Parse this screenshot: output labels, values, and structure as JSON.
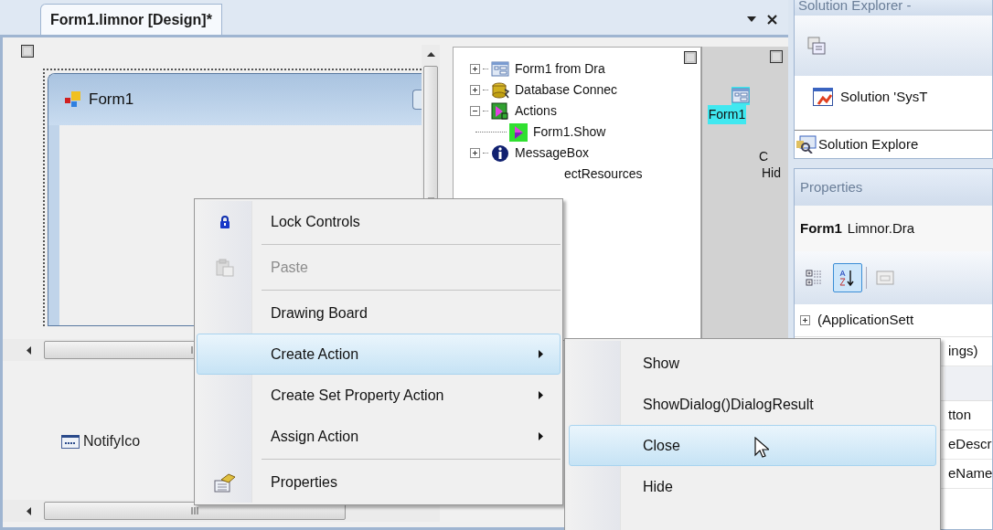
{
  "document_tab": {
    "title": "Form1.limnor [Design]*",
    "selected": true
  },
  "designer": {
    "form_title": "Form1",
    "component_tray": [
      {
        "label": "NotifyIco"
      }
    ]
  },
  "object_tree": [
    {
      "kind": "form",
      "label": "Form1 from Dra",
      "expanded": false
    },
    {
      "kind": "database",
      "label": "Database Connec",
      "expanded": false
    },
    {
      "kind": "actions",
      "label": "Actions",
      "expanded": true,
      "children": [
        {
          "kind": "action",
          "label": "Form1.Show"
        }
      ]
    },
    {
      "kind": "info",
      "label": "MessageBox",
      "expanded": false
    },
    {
      "kind": "covered",
      "label": "ectResources"
    }
  ],
  "component_strip": {
    "selected_label": "Form1",
    "texts": [
      "C",
      "Hid"
    ]
  },
  "solution_explorer": {
    "title": "Solution Explorer -",
    "tree": [
      {
        "label": "Solution 'SysT"
      }
    ],
    "tab": "Solution Explore"
  },
  "properties": {
    "title": "Properties",
    "object_name": "Form1",
    "object_type": "Limnor.Dra",
    "toolbar": [
      {
        "kind": "categorized",
        "selected": false
      },
      {
        "kind": "alphabetical",
        "selected": true
      },
      {
        "kind": "pages",
        "selected": false
      }
    ],
    "rows": [
      {
        "kind": "expandable",
        "label": "(ApplicationSett",
        "expanded": false
      },
      {
        "kind": "property",
        "label": "ings)"
      },
      {
        "kind": "category"
      },
      {
        "kind": "property",
        "label": "tton"
      },
      {
        "kind": "property",
        "label": "eDescr"
      },
      {
        "kind": "property",
        "label": "eName"
      }
    ]
  },
  "context_menu": {
    "items": [
      {
        "label": "Lock Controls",
        "kind": "lock",
        "disabled": false,
        "selected": false,
        "submenu": false,
        "separator_after": true
      },
      {
        "label": "Paste",
        "kind": "paste",
        "disabled": true,
        "selected": false,
        "submenu": false,
        "separator_after": true
      },
      {
        "label": "Drawing Board",
        "disabled": false,
        "selected": false,
        "submenu": false,
        "separator_after": false
      },
      {
        "label": "Create Action",
        "disabled": false,
        "selected": true,
        "submenu": true,
        "separator_after": false
      },
      {
        "label": "Create Set Property Action",
        "disabled": false,
        "selected": false,
        "submenu": true,
        "separator_after": false
      },
      {
        "label": "Assign Action",
        "disabled": false,
        "selected": false,
        "submenu": true,
        "separator_after": true
      },
      {
        "label": "Properties",
        "kind": "properties",
        "disabled": false,
        "selected": false,
        "submenu": false,
        "separator_after": false
      }
    ]
  },
  "submenu": {
    "items": [
      {
        "label": "Show",
        "selected": false
      },
      {
        "label": "ShowDialog()DialogResult",
        "selected": false
      },
      {
        "label": "Close",
        "selected": true
      },
      {
        "label": "Hide",
        "selected": false
      }
    ]
  }
}
